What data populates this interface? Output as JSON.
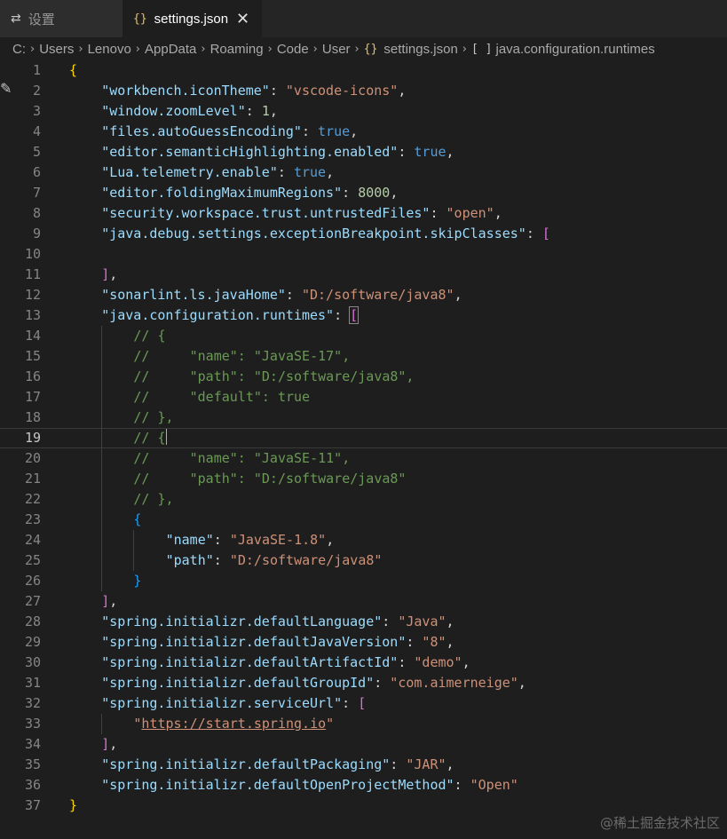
{
  "tabs": [
    {
      "label": "设置",
      "icon": "settings-sliders-icon",
      "active": false
    },
    {
      "label": "settings.json",
      "icon": "json-braces-icon",
      "active": true,
      "close": "✕"
    }
  ],
  "breadcrumb": {
    "drive": "C:",
    "folders": [
      "Users",
      "Lenovo",
      "AppData",
      "Roaming",
      "Code",
      "User"
    ],
    "file": "settings.json",
    "symbol": "java.configuration.runtimes"
  },
  "editor": {
    "current_line": 19,
    "lines": [
      {
        "n": "1",
        "code": "{"
      },
      {
        "n": "2",
        "code": "\"workbench.iconTheme\": \"vscode-icons\","
      },
      {
        "n": "3",
        "code": "\"window.zoomLevel\": 1,"
      },
      {
        "n": "4",
        "code": "\"files.autoGuessEncoding\": true,"
      },
      {
        "n": "5",
        "code": "\"editor.semanticHighlighting.enabled\": true,"
      },
      {
        "n": "6",
        "code": "\"Lua.telemetry.enable\": true,"
      },
      {
        "n": "7",
        "code": "\"editor.foldingMaximumRegions\": 8000,"
      },
      {
        "n": "8",
        "code": "\"security.workspace.trust.untrustedFiles\": \"open\","
      },
      {
        "n": "9",
        "code": "\"java.debug.settings.exceptionBreakpoint.skipClasses\": ["
      },
      {
        "n": "10",
        "code": ""
      },
      {
        "n": "11",
        "code": "],"
      },
      {
        "n": "12",
        "code": "\"sonarlint.ls.javaHome\": \"D:/software/java8\","
      },
      {
        "n": "13",
        "code": "\"java.configuration.runtimes\": ["
      },
      {
        "n": "14",
        "code": "// {"
      },
      {
        "n": "15",
        "code": "//     \"name\": \"JavaSE-17\","
      },
      {
        "n": "16",
        "code": "//     \"path\": \"D:/software/java8\","
      },
      {
        "n": "17",
        "code": "//     \"default\": true"
      },
      {
        "n": "18",
        "code": "// },"
      },
      {
        "n": "19",
        "code": "// {"
      },
      {
        "n": "20",
        "code": "//     \"name\": \"JavaSE-11\","
      },
      {
        "n": "21",
        "code": "//     \"path\": \"D:/software/java8\""
      },
      {
        "n": "22",
        "code": "// },"
      },
      {
        "n": "23",
        "code": "{"
      },
      {
        "n": "24",
        "code": "\"name\": \"JavaSE-1.8\","
      },
      {
        "n": "25",
        "code": "\"path\": \"D:/software/java8\""
      },
      {
        "n": "26",
        "code": "}"
      },
      {
        "n": "27",
        "code": "],"
      },
      {
        "n": "28",
        "code": "\"spring.initializr.defaultLanguage\": \"Java\","
      },
      {
        "n": "29",
        "code": "\"spring.initializr.defaultJavaVersion\": \"8\","
      },
      {
        "n": "30",
        "code": "\"spring.initializr.defaultArtifactId\": \"demo\","
      },
      {
        "n": "31",
        "code": "\"spring.initializr.defaultGroupId\": \"com.aimerneige\","
      },
      {
        "n": "32",
        "code": "\"spring.initializr.serviceUrl\": ["
      },
      {
        "n": "33",
        "code": "\"https://start.spring.io\""
      },
      {
        "n": "34",
        "code": "],"
      },
      {
        "n": "35",
        "code": "\"spring.initializr.defaultPackaging\": \"JAR\","
      },
      {
        "n": "36",
        "code": "\"spring.initializr.defaultOpenProjectMethod\": \"Open\""
      },
      {
        "n": "37",
        "code": "}"
      }
    ]
  },
  "gutter_icon": "pencil-edit-icon",
  "watermark": "@稀土掘金技术社区",
  "colors": {
    "background": "#1e1e1e",
    "key": "#9cdcfe",
    "string": "#ce9178",
    "number": "#b5cea8",
    "boolean": "#569cd6",
    "comment": "#6a9955",
    "bracket_level1": "#ffd700",
    "bracket_level2": "#da70d6",
    "bracket_level3": "#179fff"
  }
}
